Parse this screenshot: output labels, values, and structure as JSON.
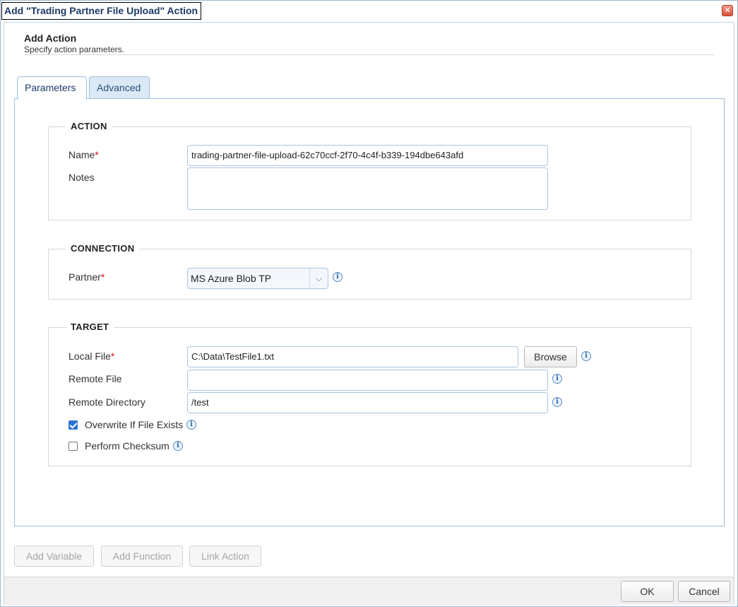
{
  "window": {
    "title": "Add \"Trading Partner File Upload\" Action",
    "close_icon": "×"
  },
  "header": {
    "title": "Add Action",
    "subtitle": "Specify action parameters."
  },
  "tabs": [
    {
      "label": "Parameters",
      "selected": true
    },
    {
      "label": "Advanced",
      "selected": false
    }
  ],
  "sections": {
    "action": {
      "legend": "ACTION",
      "name_label": "Name",
      "name_required": "*",
      "name_value": "trading-partner-file-upload-62c70ccf-2f70-4c4f-b339-194dbe643afd",
      "notes_label": "Notes",
      "notes_value": ""
    },
    "connection": {
      "legend": "CONNECTION",
      "partner_label": "Partner",
      "partner_required": "*",
      "partner_value": "MS Azure Blob TP"
    },
    "target": {
      "legend": "TARGET",
      "local_file_label": "Local File",
      "local_file_required": "*",
      "local_file_value": "C:\\Data\\TestFile1.txt",
      "browse_label": "Browse",
      "remote_file_label": "Remote File",
      "remote_file_value": "",
      "remote_dir_label": "Remote Directory",
      "remote_dir_value": "/test",
      "overwrite_label": "Overwrite If File Exists",
      "overwrite_checked": true,
      "checksum_label": "Perform Checksum",
      "checksum_checked": false
    }
  },
  "bottom_buttons": {
    "add_variable": "Add Variable",
    "add_function": "Add Function",
    "link_action": "Link Action"
  },
  "footer": {
    "ok": "OK",
    "cancel": "Cancel"
  },
  "icons": {
    "info": "i",
    "dropdown": "⌵"
  }
}
